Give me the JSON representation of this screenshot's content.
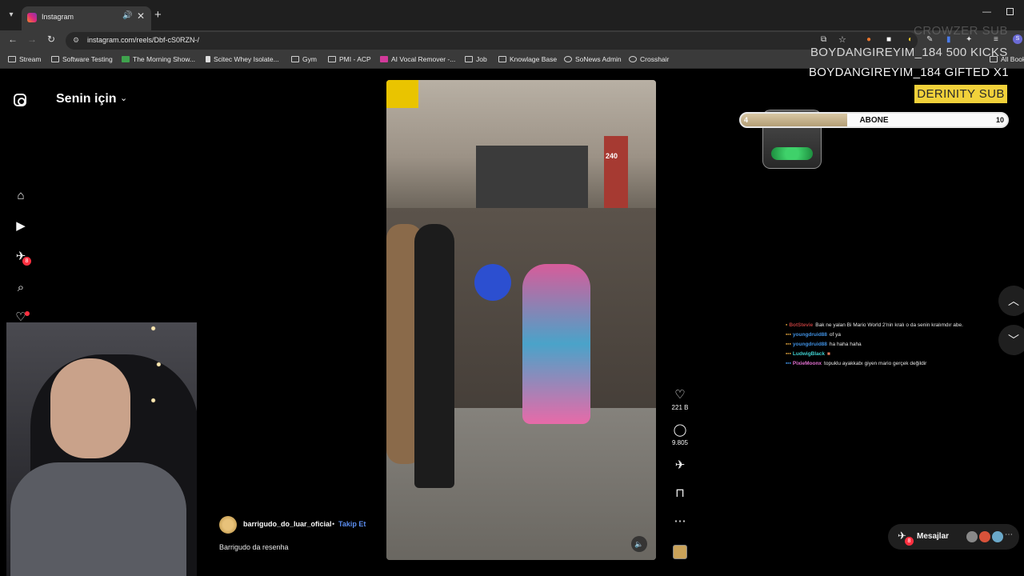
{
  "browser": {
    "tab_title": "Instagram",
    "url": "instagram.com/reels/Dbf-cS0RZN-/",
    "bookmarks": [
      "Stream",
      "Software Testing",
      "The Morning Show...",
      "Scitec Whey Isolate...",
      "Gym",
      "PMI - ACP",
      "AI Vocal Remover -...",
      "Job",
      "Knowlage Base",
      "SoNews Admin",
      "Crosshair"
    ],
    "all_bookmarks": "All Book",
    "profile_initial": "S"
  },
  "sidebar": {
    "feed_title": "Senin için",
    "notification_badge": "8",
    "icons": [
      "instagram-logo-icon",
      "home-icon",
      "reels-icon",
      "direct-icon",
      "search-icon",
      "heart-icon"
    ]
  },
  "reel": {
    "storefront_number": "240",
    "likes": "221 B",
    "comments": "9.805",
    "author": "barrigudo_do_luar_oficial",
    "separator": "•",
    "follow_label": "Takip Et",
    "caption": "Barrigudo da resenha"
  },
  "stream_overlay": {
    "ghost_text": "CROWZER  SUB",
    "line1": "BOYDANGIREYIM_184  500 KICKS",
    "line2": "BOYDANGIREYIM_184  GIFTED X1",
    "sub_name": "DERINITY  SUB",
    "goal": {
      "label": "ABONE",
      "current": "4",
      "target": "10",
      "progress": 0.4
    },
    "chat": [
      {
        "user": "BotStevie",
        "color": "#b83b3b",
        "text": "Bak ne yalan Bi Mario World 2'nin kralı o da senin kralımdır abe."
      },
      {
        "user": "youngdruid88",
        "color": "#3f8fe0",
        "text": "of ya"
      },
      {
        "user": "youngdruid88",
        "color": "#3f8fe0",
        "text": "ha haha haha"
      },
      {
        "user": "LudwigBlack",
        "color": "#3fd0d0",
        "text": ""
      },
      {
        "user": "PixieMoonx",
        "color": "#e070d0",
        "text": "topuklu ayakkabı giyen mario gerçek değildir"
      }
    ]
  },
  "messages": {
    "label": "Mesajlar",
    "badge": "8"
  },
  "colors": {
    "accent_link": "#5b8def",
    "notification": "#ff3040",
    "sub_highlight": "#f1d13a"
  }
}
